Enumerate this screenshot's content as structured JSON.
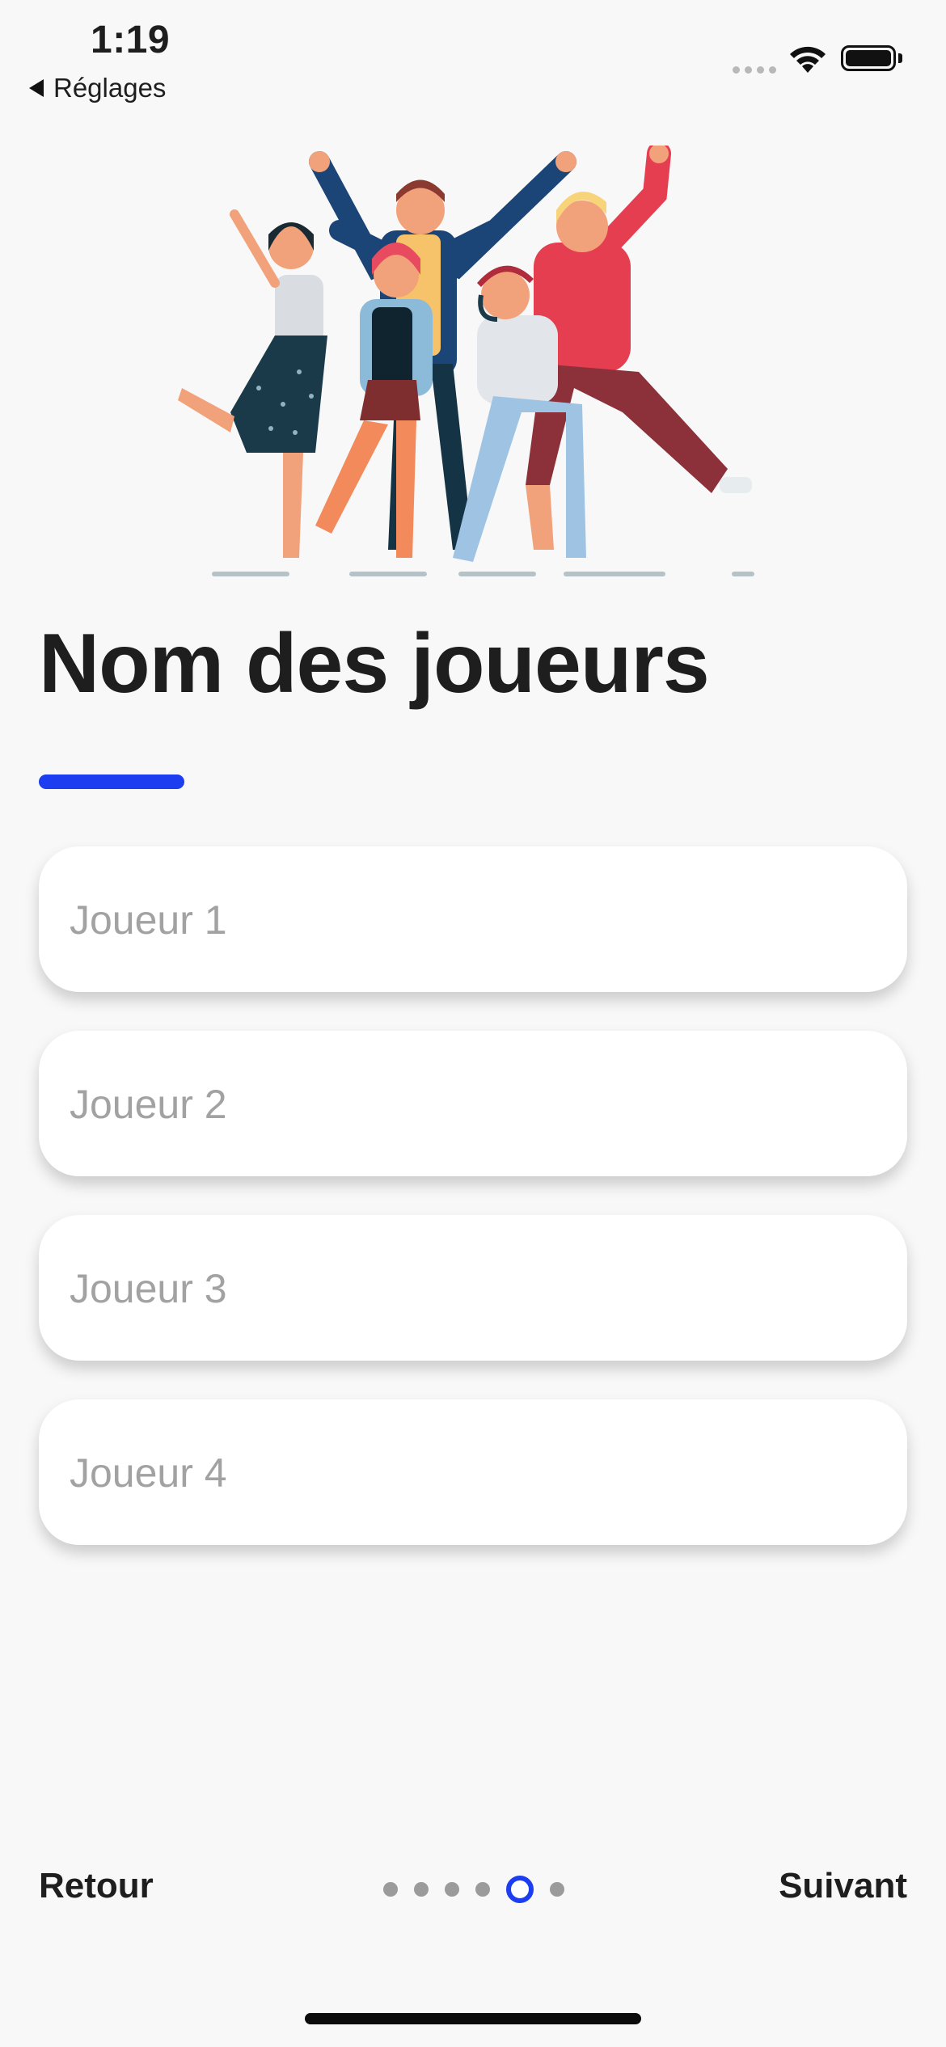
{
  "status_bar": {
    "time": "1:19",
    "back_app_label": "Réglages"
  },
  "screen": {
    "title": "Nom des joueurs",
    "accent_color": "#1d3df0"
  },
  "players": [
    {
      "placeholder": "Joueur 1",
      "value": ""
    },
    {
      "placeholder": "Joueur 2",
      "value": ""
    },
    {
      "placeholder": "Joueur 3",
      "value": ""
    },
    {
      "placeholder": "Joueur 4",
      "value": ""
    }
  ],
  "navigation": {
    "back_label": "Retour",
    "next_label": "Suivant",
    "page_count": 6,
    "current_page": 5
  },
  "icons": [
    "back-arrow-icon",
    "cellular-signal-icon",
    "wifi-icon",
    "battery-icon"
  ]
}
